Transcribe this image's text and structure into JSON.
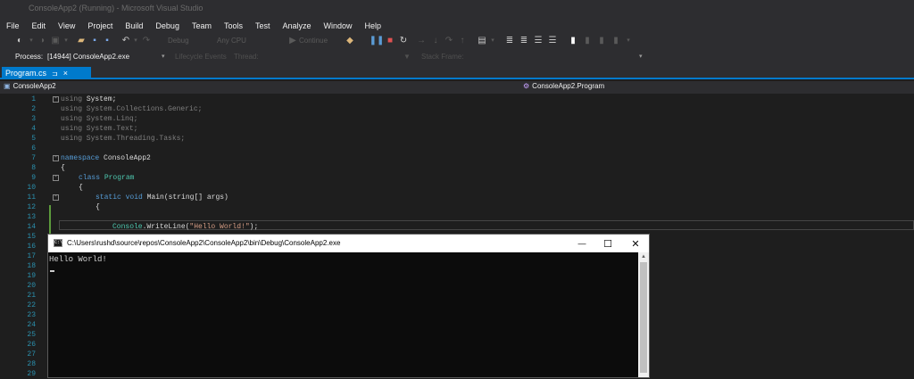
{
  "window": {
    "title": "ConsoleApp2 (Running) - Microsoft Visual Studio"
  },
  "menu": [
    "File",
    "Edit",
    "View",
    "Project",
    "Build",
    "Debug",
    "Team",
    "Tools",
    "Test",
    "Analyze",
    "Window",
    "Help"
  ],
  "toolbar": {
    "config": "Debug",
    "platform": "Any CPU",
    "continue": "Continue"
  },
  "process": {
    "label": "Process:",
    "value": "[14944] ConsoleApp2.exe",
    "lifecycle": "Lifecycle Events",
    "thread": "Thread:",
    "stackframe": "Stack Frame:"
  },
  "tab": {
    "name": "Program.cs",
    "pin": "⊐",
    "close": "×"
  },
  "nav": {
    "project": "ConsoleApp2",
    "class": "ConsoleApp2.Program"
  },
  "editor": {
    "line_numbers": [
      1,
      2,
      3,
      4,
      5,
      6,
      7,
      8,
      9,
      10,
      11,
      12,
      13,
      14,
      15,
      16,
      17,
      18,
      19,
      20,
      21,
      22,
      23,
      24,
      25,
      26,
      27,
      28,
      29
    ],
    "code": {
      "l1_using": "using",
      "l1_ns": " System;",
      "l2": "using System.Collections.Generic;",
      "l3": "using System.Linq;",
      "l4": "using System.Text;",
      "l5": "using System.Threading.Tasks;",
      "l7_kw": "namespace",
      "l7_name": " ConsoleApp2",
      "l8": "{",
      "l9_kw": "class",
      "l9_name": " Program",
      "l10": "{",
      "l11_static": "static",
      "l11_void": " void",
      "l11_rest": " Main(string[] args)",
      "l12": "{",
      "l14_ty": "Console",
      "l14_m": ".WriteLine(",
      "l14_str": "\"Hello World!\"",
      "l14_end": ");"
    }
  },
  "console": {
    "title": "C:\\Users\\rushd\\source\\repos\\ConsoleApp2\\ConsoleApp2\\bin\\Debug\\ConsoleApp2.exe",
    "output": "Hello World!",
    "minimize": "—",
    "maximize": "☐",
    "close": "✕"
  }
}
